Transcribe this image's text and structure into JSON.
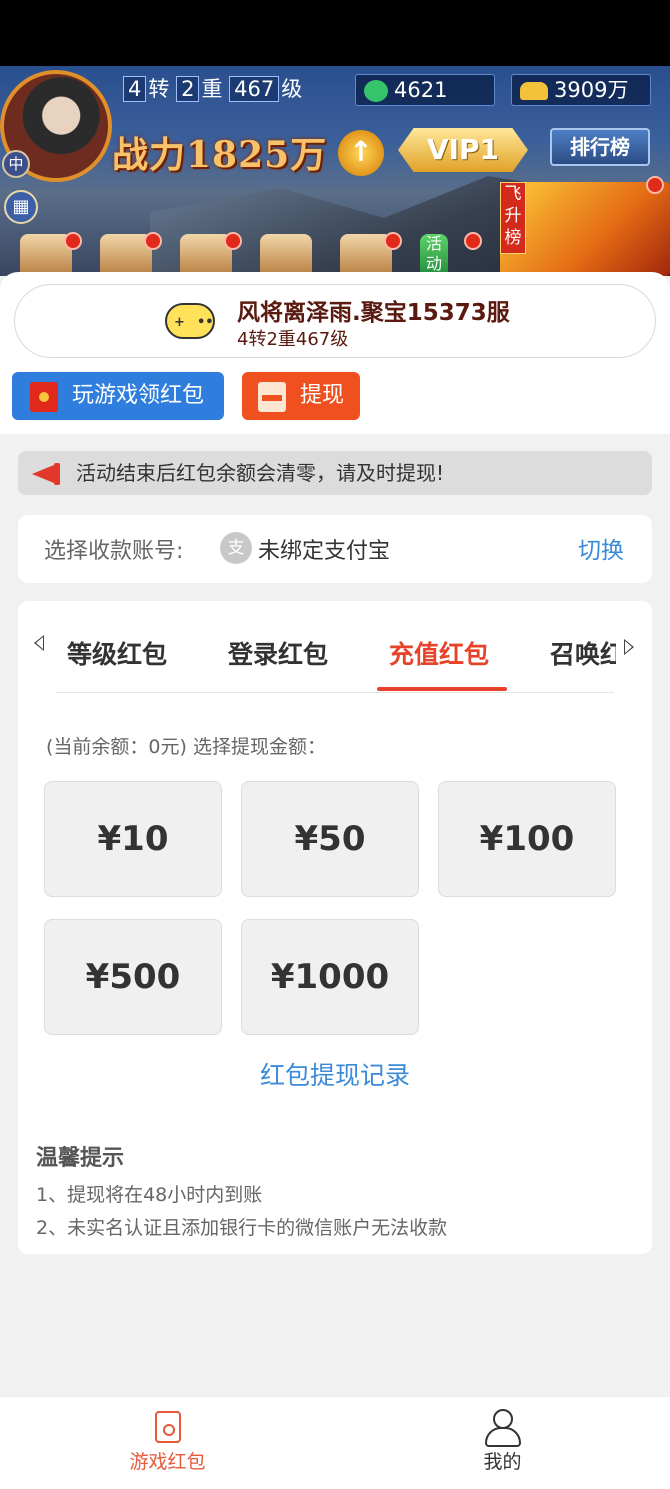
{
  "game_banner": {
    "rebirth": "4",
    "rebirth_unit": "转",
    "tier": "2",
    "tier_unit": "重",
    "level": "467",
    "level_unit": "级",
    "jade": "4621",
    "gold": "3909万",
    "power": "战力1825万",
    "vip": "VIP1",
    "rank_label": "排行榜",
    "feisheng_label": "飞升榜",
    "avatar_badge": "中",
    "activity_label": "活动"
  },
  "server": {
    "name": "风将离泽雨.聚宝15373服",
    "level_text": "4转2重467级"
  },
  "actions": {
    "play_label": "玩游戏领红包",
    "withdraw_label": "提现"
  },
  "notice": {
    "text": "活动结束后红包余额会清零，请及时提现!"
  },
  "account": {
    "label": "选择收款账号:",
    "alipay_icon_text": "支",
    "value": "未绑定支付宝",
    "switch_label": "切换"
  },
  "tabs": [
    {
      "label": "等级红包",
      "active": false
    },
    {
      "label": "登录红包",
      "active": false
    },
    {
      "label": "充值红包",
      "active": true
    },
    {
      "label": "召唤红包",
      "active": false
    }
  ],
  "withdraw": {
    "balance_text": "(当前余额：0元) 选择提现金额：",
    "amounts": [
      "¥10",
      "¥50",
      "¥100",
      "¥500",
      "¥1000"
    ],
    "record_link": "红包提现记录"
  },
  "tips": {
    "title": "温馨提示",
    "items": [
      "1、提现将在48小时内到账",
      "2、未实名认证且添加银行卡的微信账户无法收款"
    ]
  },
  "bottom_nav": [
    {
      "label": "游戏红包",
      "icon": "red-packet-icon",
      "active": true,
      "color": "#e8593a"
    },
    {
      "label": "我的",
      "icon": "user-icon",
      "active": false,
      "color": "#333333"
    }
  ],
  "colors": {
    "accent_red": "#e6432a",
    "link_blue": "#3c8bd9",
    "play_button": "#2f7ddc",
    "withdraw_button": "#f04f20"
  }
}
